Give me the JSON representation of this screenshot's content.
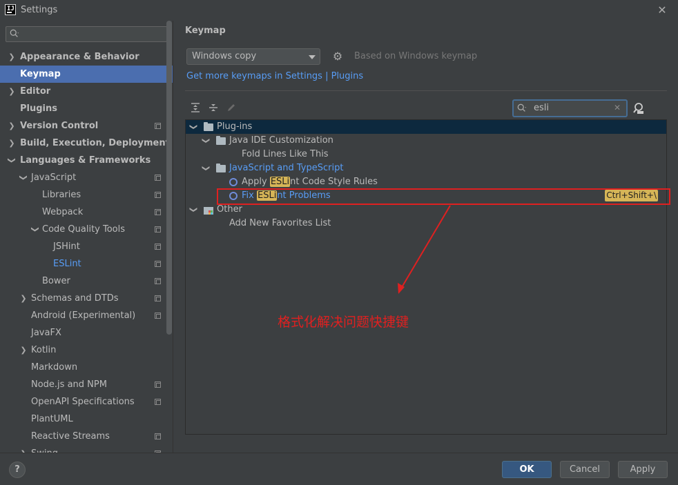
{
  "window": {
    "title": "Settings"
  },
  "sidebar": {
    "items": [
      {
        "label": "Appearance & Behavior"
      },
      {
        "label": "Keymap"
      },
      {
        "label": "Editor"
      },
      {
        "label": "Plugins"
      },
      {
        "label": "Version Control"
      },
      {
        "label": "Build, Execution, Deployment"
      },
      {
        "label": "Languages & Frameworks"
      },
      {
        "label": "JavaScript"
      },
      {
        "label": "Libraries"
      },
      {
        "label": "Webpack"
      },
      {
        "label": "Code Quality Tools"
      },
      {
        "label": "JSHint"
      },
      {
        "label": "ESLint"
      },
      {
        "label": "Bower"
      },
      {
        "label": "Schemas and DTDs"
      },
      {
        "label": "Android (Experimental)"
      },
      {
        "label": "JavaFX"
      },
      {
        "label": "Kotlin"
      },
      {
        "label": "Markdown"
      },
      {
        "label": "Node.js and NPM"
      },
      {
        "label": "OpenAPI Specifications"
      },
      {
        "label": "PlantUML"
      },
      {
        "label": "Reactive Streams"
      },
      {
        "label": "Swing"
      }
    ]
  },
  "main": {
    "title": "Keymap",
    "keymap_value": "Windows copy",
    "based_on": "Based on Windows keymap",
    "get_more": "Get more keymaps in Settings | Plugins",
    "search_value": "esli",
    "tree": {
      "plugins": "Plug-ins",
      "java_ide": "Java IDE Customization",
      "fold_lines": "Fold Lines Like This",
      "js_ts": "JavaScript and TypeScript",
      "apply_pre": "Apply ",
      "apply_hl": "ESLi",
      "apply_post": "nt Code Style Rules",
      "fix_pre": "Fix ",
      "fix_hl": "ESLi",
      "fix_post": "nt Problems",
      "fix_shortcut": "Ctrl+Shift+\\",
      "other": "Other",
      "add_fav": "Add New Favorites List"
    },
    "annotation": "格式化解决问题快捷键"
  },
  "footer": {
    "help": "?",
    "ok": "OK",
    "cancel": "Cancel",
    "apply": "Apply"
  },
  "colors": {
    "accent": "#4b6eaf",
    "link": "#589df6",
    "highlight": "#d6b557",
    "annotation": "#e02020"
  }
}
